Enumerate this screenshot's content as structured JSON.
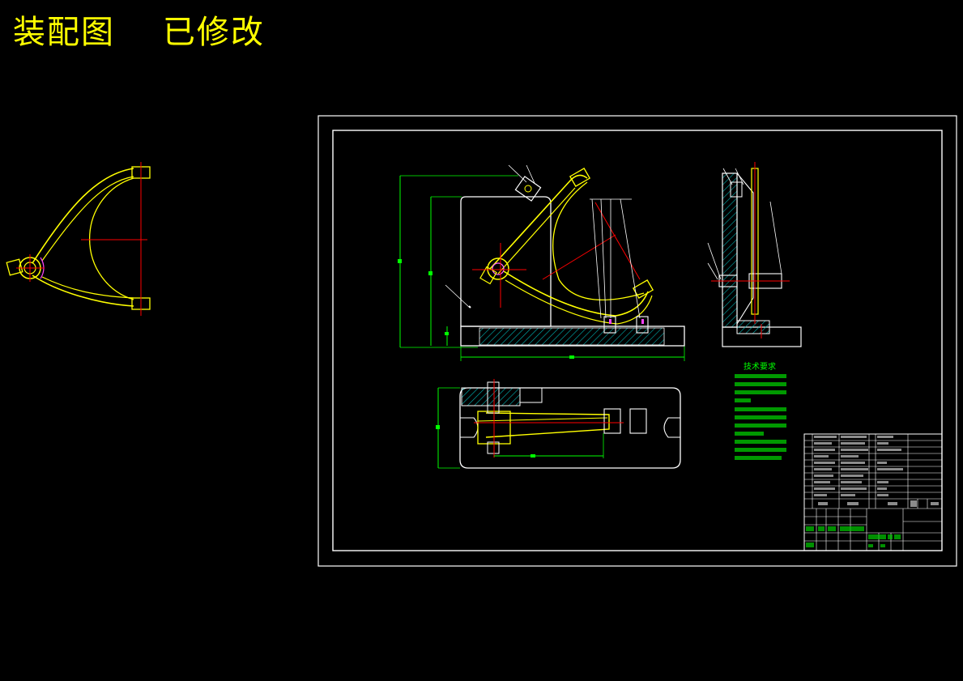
{
  "drawing": {
    "title": "装配图    已修改",
    "tech_requirements_title": "技术要求",
    "colors": {
      "background": "#000000",
      "title": "#ffff00",
      "part": "#ffff00",
      "outline": "#ffffff",
      "dimension": "#00ff00",
      "centerline": "#ff0000",
      "hatch": "#00cccc",
      "leader": "#ffffff"
    }
  }
}
